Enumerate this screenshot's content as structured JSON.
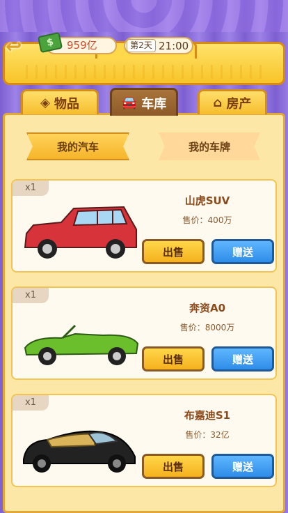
{
  "header": {
    "money": "959亿",
    "day": "第2天",
    "time": "21:00"
  },
  "tabs": [
    {
      "label": "物品",
      "icon": "diamond-icon"
    },
    {
      "label": "车库",
      "icon": "car-icon"
    },
    {
      "label": "房产",
      "icon": "house-icon"
    }
  ],
  "subtabs": [
    {
      "label": "我的汽车"
    },
    {
      "label": "我的车牌"
    }
  ],
  "cars": [
    {
      "qty": "x1",
      "name": "山虎SUV",
      "price": "售价：400万",
      "sell": "出售",
      "gift": "赠送",
      "color": "#d6333b"
    },
    {
      "qty": "x1",
      "name": "奔资A0",
      "price": "售价：8000万",
      "sell": "出售",
      "gift": "赠送",
      "color": "#6bbf2d"
    },
    {
      "qty": "x1",
      "name": "布嘉迪S1",
      "price": "售价：32亿",
      "sell": "出售",
      "gift": "赠送",
      "color": "#222222"
    }
  ],
  "colors": {
    "panel_bg": "#fce7a6",
    "accent_yellow": "#f6bd2e",
    "active_tab": "#8d5a28",
    "gift_blue": "#2f8de8"
  }
}
